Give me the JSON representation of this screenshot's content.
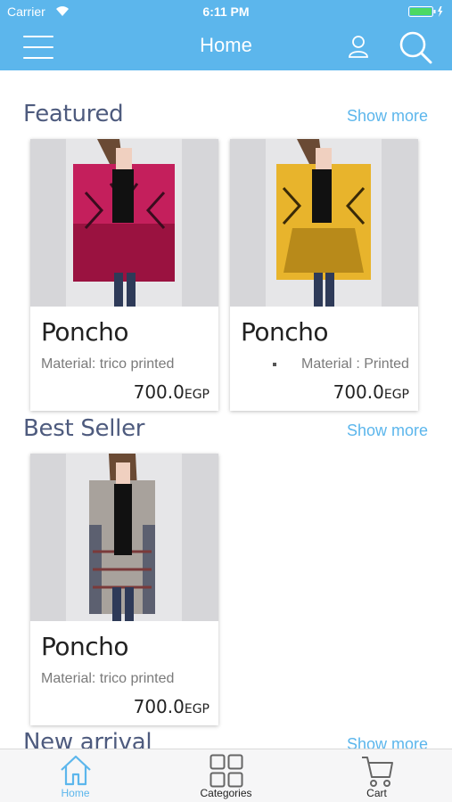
{
  "status_bar": {
    "carrier": "Carrier",
    "time": "6:11 PM"
  },
  "header": {
    "title": "Home",
    "icons": [
      "menu-icon",
      "user-icon",
      "search-icon"
    ]
  },
  "sections": {
    "featured": {
      "title": "Featured",
      "show_more": "Show more",
      "products": [
        {
          "name": "Poncho",
          "description": "Material: trico printed",
          "price": "700.0",
          "currency": "EGP",
          "image_color": "#c41f5c"
        },
        {
          "name": "Poncho",
          "description": "Material : Printed trico",
          "price": "700.0",
          "currency": "EGP",
          "image_color": "#e8b42c"
        }
      ]
    },
    "best_seller": {
      "title": "Best Seller",
      "show_more": "Show more",
      "products": [
        {
          "name": "Poncho",
          "description": "Material: trico printed",
          "price": "700.0",
          "currency": "EGP",
          "image_color": "#a8a29c"
        }
      ]
    },
    "new_arrival": {
      "title": "New arrival",
      "show_more": "Show more"
    }
  },
  "tabbar": {
    "tabs": [
      {
        "label": "Home",
        "icon": "home-icon",
        "active": true
      },
      {
        "label": "Categories",
        "icon": "grid-icon",
        "active": false
      },
      {
        "label": "Cart",
        "icon": "cart-icon",
        "active": false
      }
    ]
  },
  "colors": {
    "accent": "#5cb6ec",
    "section_title": "#4e5b7e"
  }
}
